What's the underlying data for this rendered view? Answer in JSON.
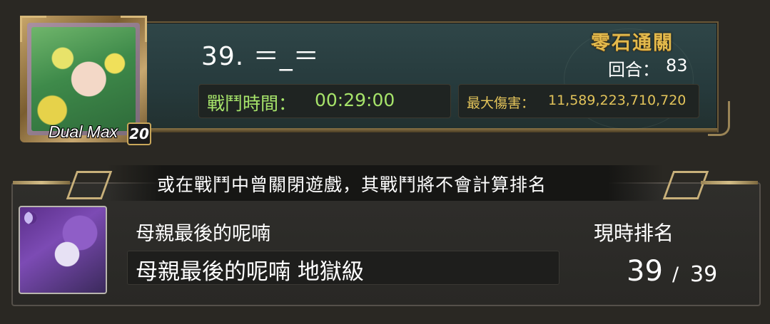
{
  "player": {
    "name": "39. ＝_＝",
    "avatar_label": "Dual Max",
    "avatar_level": "20"
  },
  "battle": {
    "time_label": "戰鬥時間：",
    "time_value": "00:29:00"
  },
  "damage": {
    "label": "最大傷害：",
    "value": "11,589,223,710,720"
  },
  "status": {
    "clear_title": "零石通關",
    "round_label": "回合：",
    "round_value": "83"
  },
  "notice": "或在戰鬥中曾關閉遊戲，其戰鬥將不會計算排名",
  "stage": {
    "name": "母親最後的呢喃",
    "full_name": "母親最後的呢喃 地獄級"
  },
  "ranking": {
    "label": "現時排名",
    "current": "39",
    "separator": "/",
    "total": "39"
  },
  "colors": {
    "battle_text": "#a6e36a",
    "damage_text": "#e2c35a",
    "clear_title": "#e2b94c"
  }
}
